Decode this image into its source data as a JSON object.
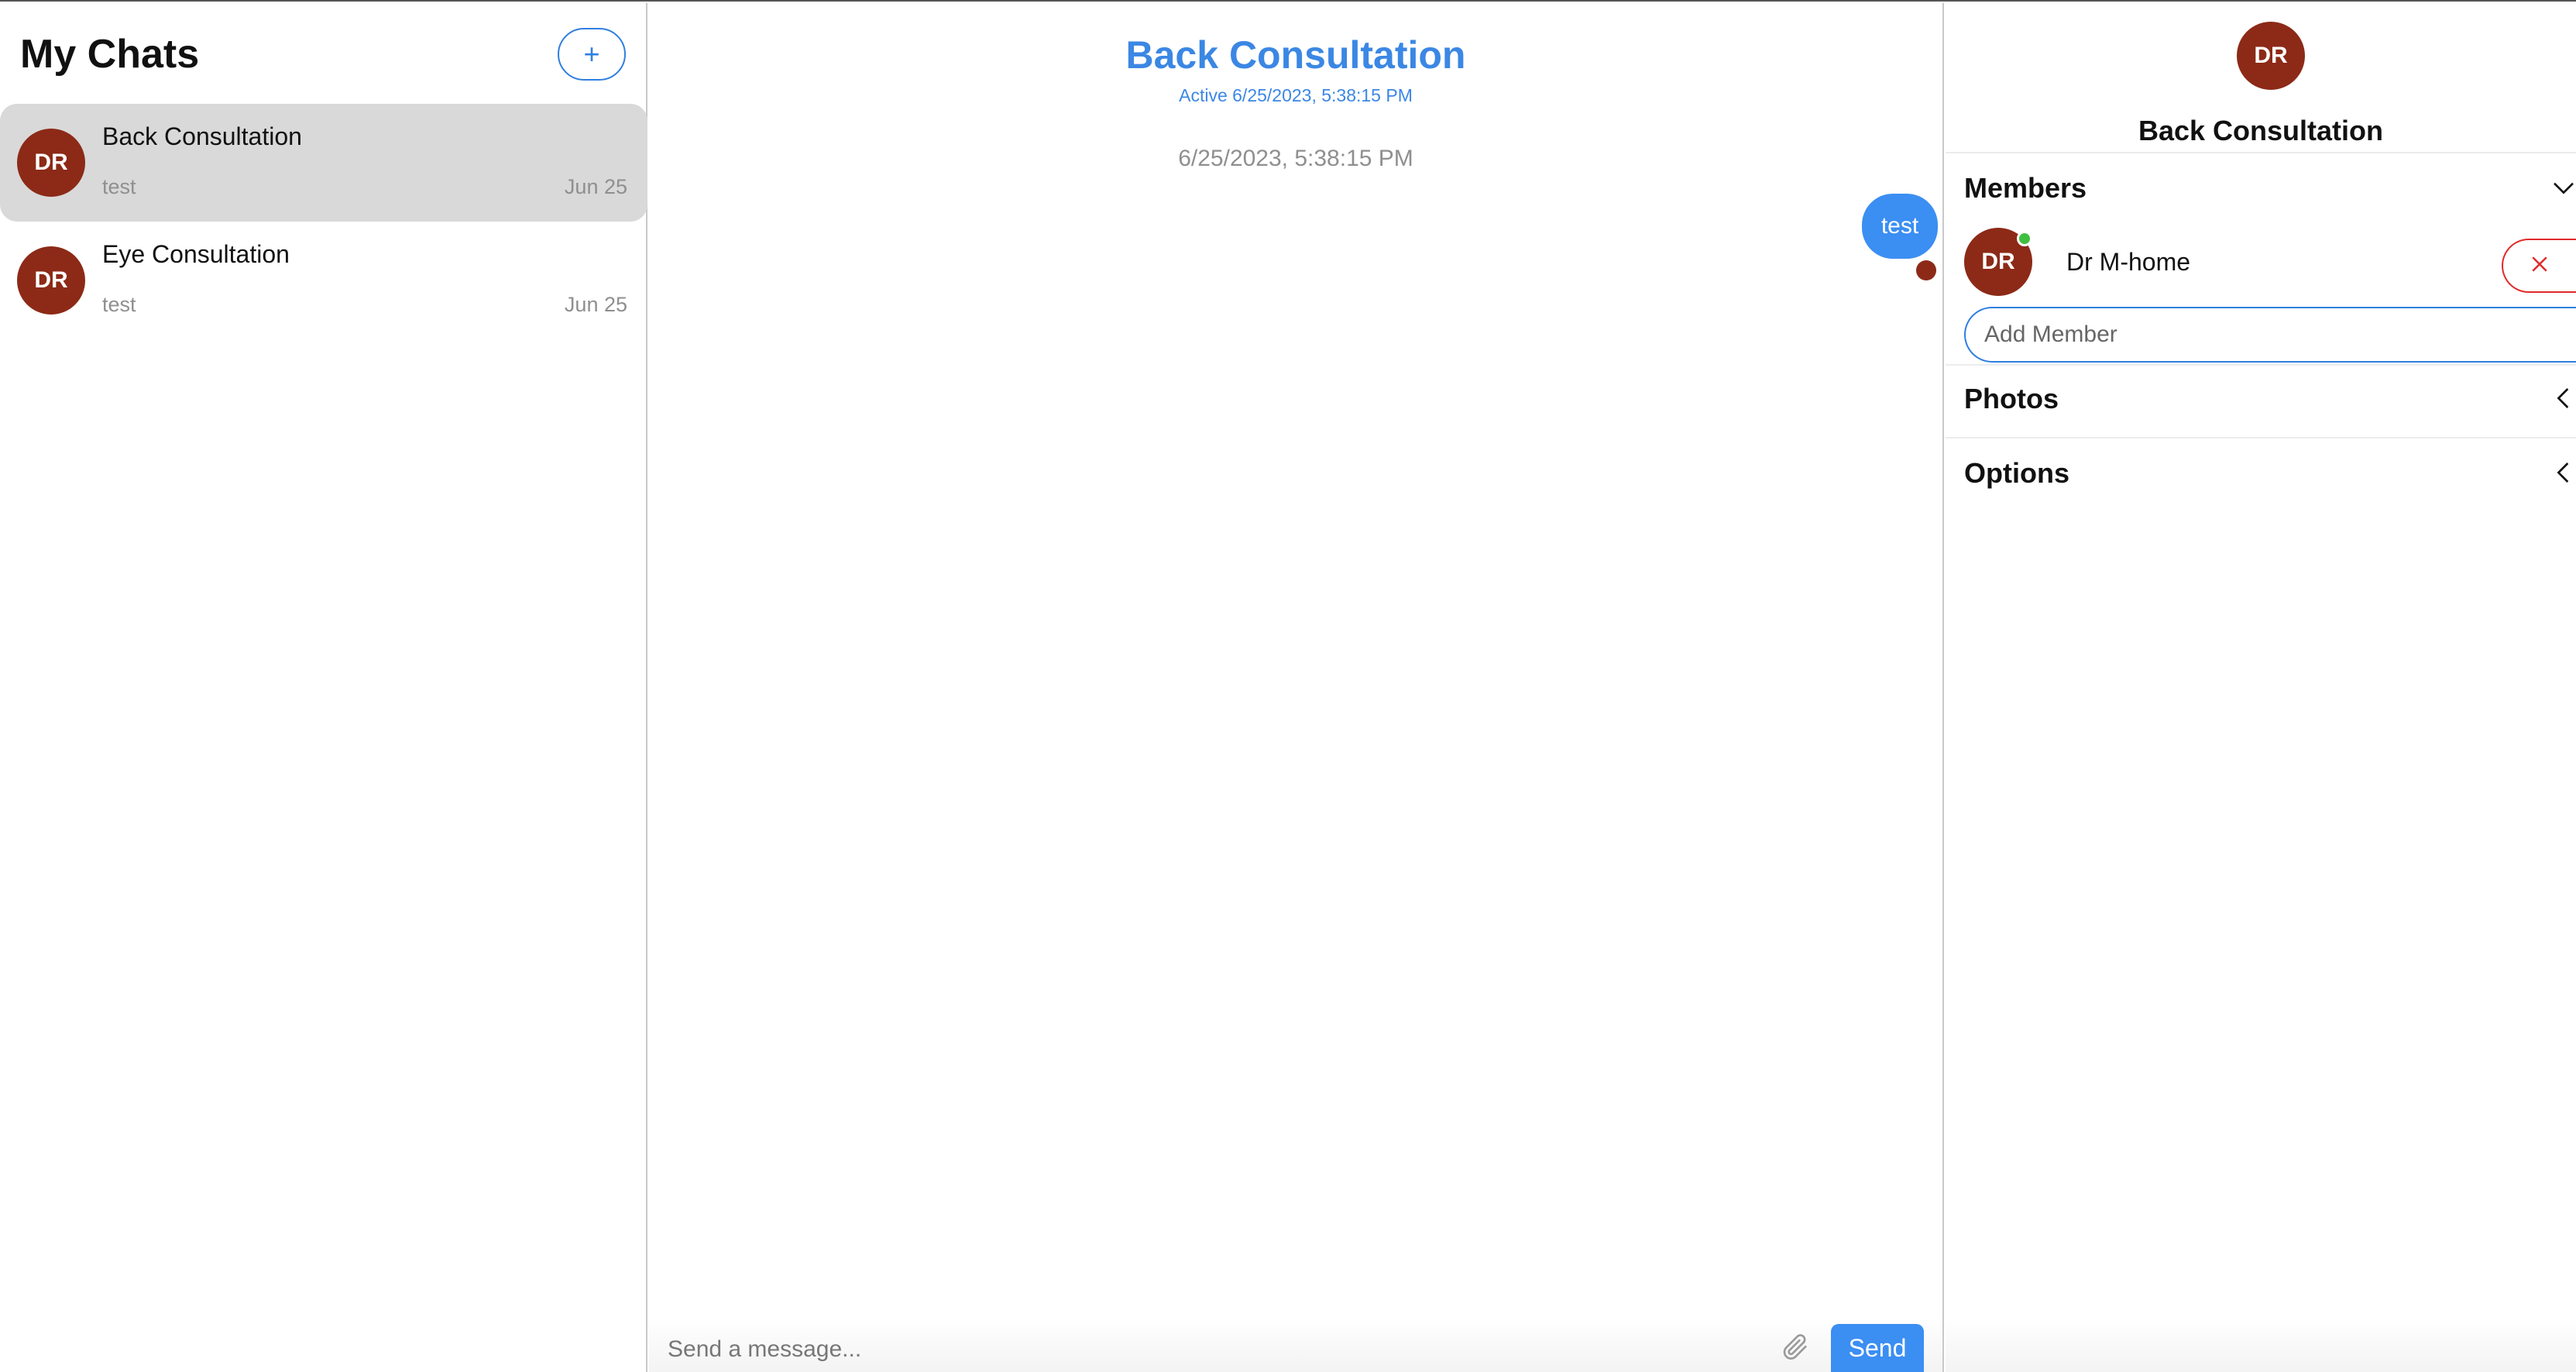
{
  "sidebar": {
    "title": "My Chats",
    "new_chat_label": "+",
    "chats": [
      {
        "initials": "DR",
        "name": "Back Consultation",
        "preview": "test",
        "date": "Jun 25",
        "active": true
      },
      {
        "initials": "DR",
        "name": "Eye Consultation",
        "preview": "test",
        "date": "Jun 25",
        "active": false
      }
    ]
  },
  "conversation": {
    "title": "Back Consultation",
    "status": "Active 6/25/2023, 5:38:15 PM",
    "date_separator": "6/25/2023, 5:38:15 PM",
    "messages": [
      {
        "text": "test",
        "outgoing": true
      }
    ],
    "composer": {
      "placeholder": "Send a message...",
      "send_label": "Send"
    }
  },
  "info_panel": {
    "initials": "DR",
    "title": "Back Consultation",
    "members_label": "Members",
    "members": [
      {
        "initials": "DR",
        "name": "Dr M-home",
        "online": true
      }
    ],
    "add_member_placeholder": "Add Member",
    "photos_label": "Photos",
    "options_label": "Options"
  },
  "colors": {
    "accent": "#3b8ef2",
    "avatar": "#8c2a17",
    "online": "#3fbf3f",
    "danger": "#e02a2a"
  }
}
